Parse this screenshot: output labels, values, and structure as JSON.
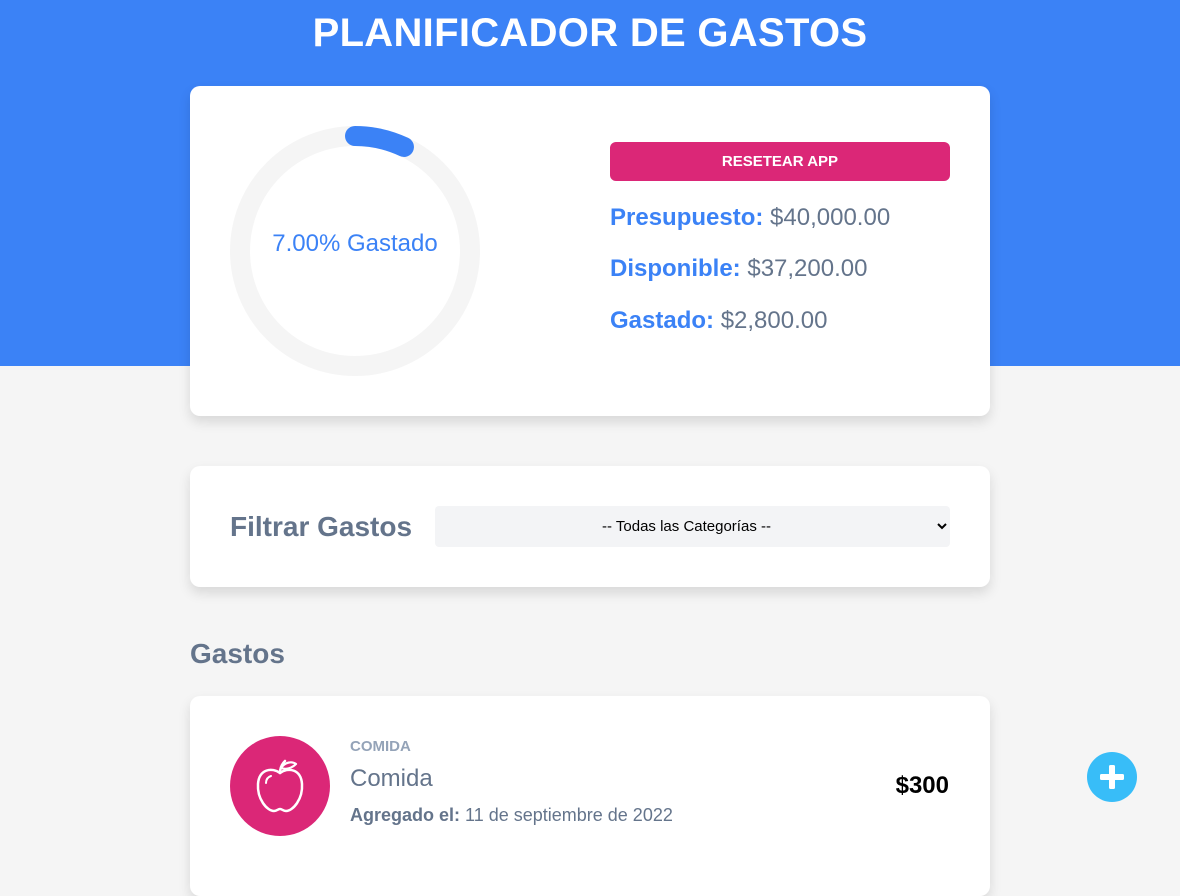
{
  "header": {
    "title": "PLANIFICADOR DE GASTOS"
  },
  "budget": {
    "progress_percent": 7,
    "progress_text": "7.00% Gastado",
    "reset_label": "RESETEAR APP",
    "presupuesto_label": "Presupuesto:",
    "presupuesto_value": "$40,000.00",
    "disponible_label": "Disponible:",
    "disponible_value": "$37,200.00",
    "gastado_label": "Gastado:",
    "gastado_value": "$2,800.00"
  },
  "filter": {
    "title": "Filtrar Gastos",
    "selected_option": "-- Todas las Categorías --"
  },
  "expenses": {
    "title": "Gastos",
    "items": [
      {
        "category": "COMIDA",
        "name": "Comida",
        "date_label": "Agregado el:",
        "date_value": "11 de septiembre de 2022",
        "amount": "$300",
        "icon": "apple-icon"
      }
    ]
  },
  "fab": {
    "icon": "plus-icon"
  },
  "colors": {
    "primary": "#3b82f6",
    "accent": "#db2777",
    "fab": "#38bdf8",
    "text_muted": "#64748b",
    "track": "#f5f5f5"
  }
}
